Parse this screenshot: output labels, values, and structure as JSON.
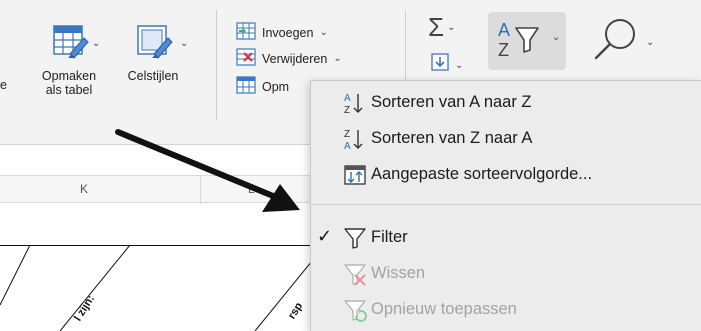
{
  "ribbon": {
    "cut_label": "e",
    "format_table": {
      "line1": "Opmaken",
      "line2": "als tabel",
      "icon": "table-format-icon"
    },
    "cell_styles": {
      "label": "Celstijlen",
      "icon": "cell-styles-icon"
    },
    "insert": {
      "label": "Invoegen",
      "icon": "insert-cells-icon"
    },
    "delete": {
      "label": "Verwijderen",
      "icon": "delete-cells-icon"
    },
    "format": {
      "label": "Opm",
      "icon": "format-cells-icon"
    },
    "autosum_icon": "sigma-icon",
    "fill_icon": "fill-down-icon",
    "sort_filter_icon": "sort-filter-icon",
    "find_icon": "magnifier-icon"
  },
  "sheet": {
    "col_k": "K",
    "col_l": "L",
    "diag_text_1": "l zijn:",
    "diag_text_2": "rsp"
  },
  "menu": {
    "items": [
      {
        "label": "Sorteren van A naar Z",
        "icon": "sort-az-icon",
        "enabled": true
      },
      {
        "label": "Sorteren van Z naar A",
        "icon": "sort-za-icon",
        "enabled": true
      },
      {
        "label": "Aangepaste sorteervolgorde...",
        "icon": "custom-sort-icon",
        "enabled": true
      },
      {
        "label": "Filter",
        "icon": "filter-icon",
        "enabled": true,
        "checked": true,
        "check": "✓"
      },
      {
        "label": "Wissen",
        "icon": "clear-filter-icon",
        "enabled": false
      },
      {
        "label": "Opnieuw toepassen",
        "icon": "reapply-filter-icon",
        "enabled": false
      }
    ]
  },
  "colors": {
    "accent": "#2b6fb6",
    "disabled": "#a3a3a3",
    "danger": "#d9363e",
    "reapply": "#2aa84a"
  }
}
